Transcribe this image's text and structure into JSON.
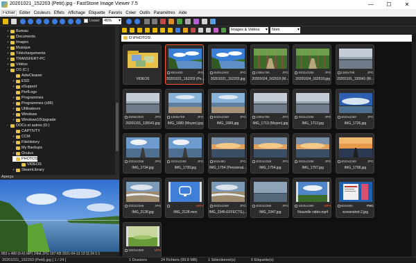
{
  "window": {
    "title": "20201021_152203 (Petit).jpg - FastStone Image Viewer 7.5",
    "buttons": {
      "minimize": "—",
      "maximize": "☐",
      "close": "✕"
    }
  },
  "menu": [
    "Fichier",
    "Editer",
    "Couleurs",
    "Effets",
    "Affichage",
    "Etiquette",
    "Favoris",
    "Créer",
    "Outils",
    "Paramètres",
    "Aide"
  ],
  "toolbar": {
    "smooth_label": "Lisser",
    "zoom_value": "45%"
  },
  "browser_toolbar": {
    "filter_value": "Images & Vidéos",
    "sort_value": "Nom"
  },
  "path": "D:\\PHOTOS\\",
  "tree": [
    {
      "label": "Bureau",
      "indent": 1,
      "toggle": "+"
    },
    {
      "label": "Documents",
      "indent": 1,
      "toggle": "+"
    },
    {
      "label": "Images",
      "indent": 1,
      "toggle": "+"
    },
    {
      "label": "Musique",
      "indent": 1,
      "toggle": "+"
    },
    {
      "label": "Téléchargements",
      "indent": 1,
      "toggle": "+"
    },
    {
      "label": "TRANSFERT-PC",
      "indent": 1,
      "toggle": "+"
    },
    {
      "label": "Vidéos",
      "indent": 1,
      "toggle": "+"
    },
    {
      "label": "OS (C:)",
      "indent": 1,
      "toggle": "-"
    },
    {
      "label": "AdwCleaner",
      "indent": 2,
      "toggle": ""
    },
    {
      "label": "ESD",
      "indent": 2,
      "toggle": "+"
    },
    {
      "label": "eSupport",
      "indent": 2,
      "toggle": "+"
    },
    {
      "label": "PerfLogs",
      "indent": 2,
      "toggle": ""
    },
    {
      "label": "Programmes",
      "indent": 2,
      "toggle": "+"
    },
    {
      "label": "Programmes (x86)",
      "indent": 2,
      "toggle": "+"
    },
    {
      "label": "Utilisateurs",
      "indent": 2,
      "toggle": "+"
    },
    {
      "label": "Windows",
      "indent": 2,
      "toggle": "+"
    },
    {
      "label": "Windows10Upgrade",
      "indent": 2,
      "toggle": "+"
    },
    {
      "label": "DOCs et autres (D:)",
      "indent": 1,
      "toggle": "-"
    },
    {
      "label": "CAPTIVTY",
      "indent": 2,
      "toggle": ""
    },
    {
      "label": "CCM",
      "indent": 2,
      "toggle": "+"
    },
    {
      "label": "FileHistory",
      "indent": 2,
      "toggle": "+"
    },
    {
      "label": "My Backups",
      "indent": 2,
      "toggle": ""
    },
    {
      "label": "Oculus",
      "indent": 2,
      "toggle": "+"
    },
    {
      "label": "PHOTOS",
      "indent": 2,
      "toggle": "-",
      "selected": true
    },
    {
      "label": "VIDEOS",
      "indent": 3,
      "toggle": ""
    },
    {
      "label": "SteamLibrary",
      "indent": 2,
      "toggle": "+"
    }
  ],
  "preview": {
    "header": "Aperçu",
    "status": "853 x 480 (0.41 MP)  24bit  JPG  167 KB  2021-04-13 12:11:24  1:1"
  },
  "thumbnails": [
    {
      "name": "VIDEOS",
      "dims": "",
      "ext": "",
      "kind": "folder"
    },
    {
      "name": "20201021_152203 (Pe...",
      "dims": "853x480",
      "ext": "JPG",
      "kind": "sky",
      "selected": true
    },
    {
      "name": "20201021_152203.jpg",
      "dims": "4608x2592",
      "ext": "JPG",
      "kind": "sky"
    },
    {
      "name": "20201024_162519 (M...",
      "dims": "1365x768",
      "ext": "JPG",
      "kind": "forest"
    },
    {
      "name": "20201024_162519.jpg",
      "dims": "4032x2268",
      "ext": "JPG",
      "kind": "forest"
    },
    {
      "name": "20201101_135541 (M...",
      "dims": "1365x768",
      "ext": "JPG",
      "kind": "grey"
    },
    {
      "name": "20201101_135541.jpg",
      "dims": "4608x2592",
      "ext": "JPG",
      "kind": "grey"
    },
    {
      "name": "IMG_1689 (Moyen).jpg",
      "dims": "1365x768",
      "ext": "JPG",
      "kind": "sea"
    },
    {
      "name": "IMG_1689.jpg",
      "dims": "4032x2268",
      "ext": "JPG",
      "kind": "sea"
    },
    {
      "name": "IMG_1713 (Moyen).jpg",
      "dims": "1365x768",
      "ext": "JPG",
      "kind": "grey"
    },
    {
      "name": "IMG_1713.jpg",
      "dims": "4032x2268",
      "ext": "JPG",
      "kind": "grey"
    },
    {
      "name": "IMG_1726.jpg",
      "dims": "4032x2268",
      "ext": "JPG",
      "kind": "bluesky"
    },
    {
      "name": "IMG_1734.jpg",
      "dims": "4032x2268",
      "ext": "JPG",
      "kind": "pier"
    },
    {
      "name": "IMG_1739.jpg",
      "dims": "4032x2268",
      "ext": "JPG",
      "kind": "pier"
    },
    {
      "name": "IMG_1754 (Personnal...",
      "dims": "640x480",
      "ext": "JPG",
      "kind": "sunset"
    },
    {
      "name": "IMG_1754.jpg",
      "dims": "4032x2268",
      "ext": "JPG",
      "kind": "sunset"
    },
    {
      "name": "IMG_1757.jpg",
      "dims": "4032x2268",
      "ext": "JPG",
      "kind": "sunset"
    },
    {
      "name": "IMG_1758.jpg",
      "dims": "4032x2268",
      "ext": "JPG",
      "kind": "sunset2"
    },
    {
      "name": "IMG_2128.jpg",
      "dims": "4032x2268",
      "ext": "JPG",
      "kind": "beach"
    },
    {
      "name": "IMG_2128.mov",
      "dims": "",
      "ext": "MOV",
      "kind": "video"
    },
    {
      "name": "IMG_2345-EFFECTS.j...",
      "dims": "4032x2268",
      "ext": "JPG",
      "kind": "beach"
    },
    {
      "name": "IMG_2347.jpg",
      "dims": "4032x2268",
      "ext": "JPG",
      "kind": "cloudy"
    },
    {
      "name": "Nouvelle vidéo.mp4",
      "dims": "1920x1080",
      "ext": "MP4",
      "kind": "filmsky"
    },
    {
      "name": "screenshot-2.jpg",
      "dims": "600x600",
      "ext": "PNG",
      "kind": "screen"
    },
    {
      "name": "",
      "dims": "1920x1080",
      "ext": "MP4",
      "kind": "filmgrass"
    }
  ],
  "statusbar": {
    "dossiers": "1 Dossiers",
    "fichiers": "24 Fichiers (99.8 MB)",
    "selection": "1 Sélectionné(s)",
    "etiquette": "0 Etiquette(s)",
    "filename": "20201021_152203 (Petit).jpg [ 1 / 24 ]"
  }
}
